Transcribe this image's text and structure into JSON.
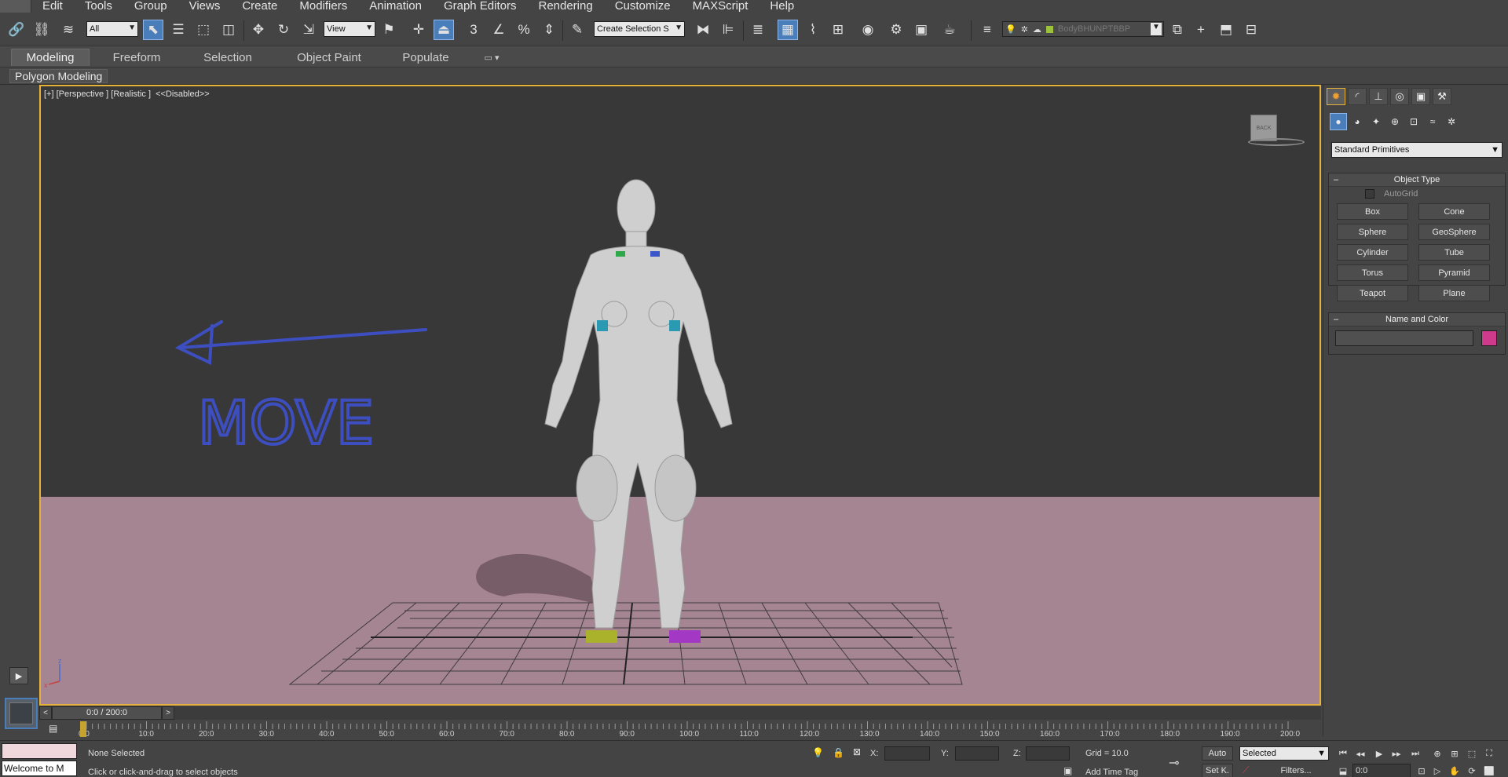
{
  "menubar": {
    "items": [
      "Edit",
      "Tools",
      "Group",
      "Views",
      "Create",
      "Modifiers",
      "Animation",
      "Graph Editors",
      "Rendering",
      "Customize",
      "MAXScript",
      "Help"
    ]
  },
  "toolbar": {
    "selection_filter": "All",
    "reference_coord": "View",
    "snap_angle_label": "3",
    "percent_snap_label": "%",
    "named_selection_placeholder": "Create Selection S",
    "layer_name": "BodyBHUNPTBBP"
  },
  "ribbon": {
    "tabs": [
      "Modeling",
      "Freeform",
      "Selection",
      "Object Paint",
      "Populate"
    ],
    "active_tab": "Modeling",
    "panel_label": "Polygon Modeling"
  },
  "viewport": {
    "label": "[+] [Perspective ] [Realistic ]  <<Disabled>>",
    "viewcube_face": "BACK",
    "annotation_text": "MOVE",
    "axis_x": "x",
    "axis_z": "z"
  },
  "command_panel": {
    "tabs": [
      "create-icon",
      "modify-icon",
      "hierarchy-icon",
      "motion-icon",
      "display-icon",
      "utilities-icon"
    ],
    "categories": [
      "geometry-icon",
      "shapes-icon",
      "lights-icon",
      "cameras-icon",
      "helpers-icon",
      "spacewarps-icon",
      "systems-icon"
    ],
    "dropdown": "Standard Primitives",
    "object_type_title": "Object Type",
    "autogrid_label": "AutoGrid",
    "buttons": [
      "Box",
      "Cone",
      "Sphere",
      "GeoSphere",
      "Cylinder",
      "Tube",
      "Torus",
      "Pyramid",
      "Teapot",
      "Plane"
    ],
    "name_color_title": "Name and Color",
    "object_color": "#d03a8c"
  },
  "timeline": {
    "frame_display": "0:0 / 200:0",
    "prev": "<",
    "next": ">",
    "ticks": [
      "0:0",
      "10:0",
      "20:0",
      "30:0",
      "40:0",
      "50:0",
      "60:0",
      "70:0",
      "80:0",
      "90:0",
      "100:0",
      "110:0",
      "120:0",
      "130:0",
      "140:0",
      "150:0",
      "160:0",
      "170:0",
      "180:0",
      "190:0",
      "200:0"
    ]
  },
  "status": {
    "maxscript_listener": "Welcome to M",
    "selection_status": "None Selected",
    "prompt": "Click or click-and-drag to select objects",
    "x_label": "X:",
    "y_label": "Y:",
    "z_label": "Z:",
    "grid": "Grid = 10.0",
    "add_time_tag": "Add Time Tag",
    "auto_key": "Auto",
    "set_key": "Set K.",
    "key_filter_select": "Selected",
    "filters": "Filters...",
    "current_frame": "0:0"
  },
  "colors": {
    "viewport_border": "#e6b23a",
    "ground": "#a68592",
    "annotation": "#3d4ec0",
    "active_blue": "#4a7ebb"
  }
}
